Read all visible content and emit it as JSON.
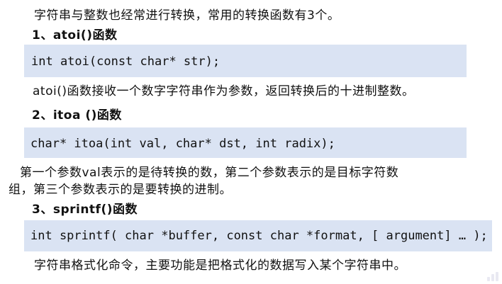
{
  "intro": "字符串与整数也经常进行转换，常用的转换函数有3个。",
  "sections": [
    {
      "heading": "1、atoi()函数",
      "code": "int atoi(const char* str);",
      "description": [
        "atoi()函数接收一个数字字符串作为参数，返回转换后的十进制整数。"
      ]
    },
    {
      "heading": "2、itoa ()函数",
      "code": "char* itoa(int val, char* dst, int radix);",
      "description": [
        "  第一个参数val表示的是待转换的数，第二个参数表示的是目标字符数",
        "组，第三个参数表示的是要转换的进制。"
      ]
    },
    {
      "heading": "3、sprintf()函数",
      "code": "int sprintf( char *buffer, const char *format, [ argument] … );",
      "description": [
        "字符串格式化命令，主要功能是把格式化的数据写入某个字符串中。"
      ]
    }
  ]
}
